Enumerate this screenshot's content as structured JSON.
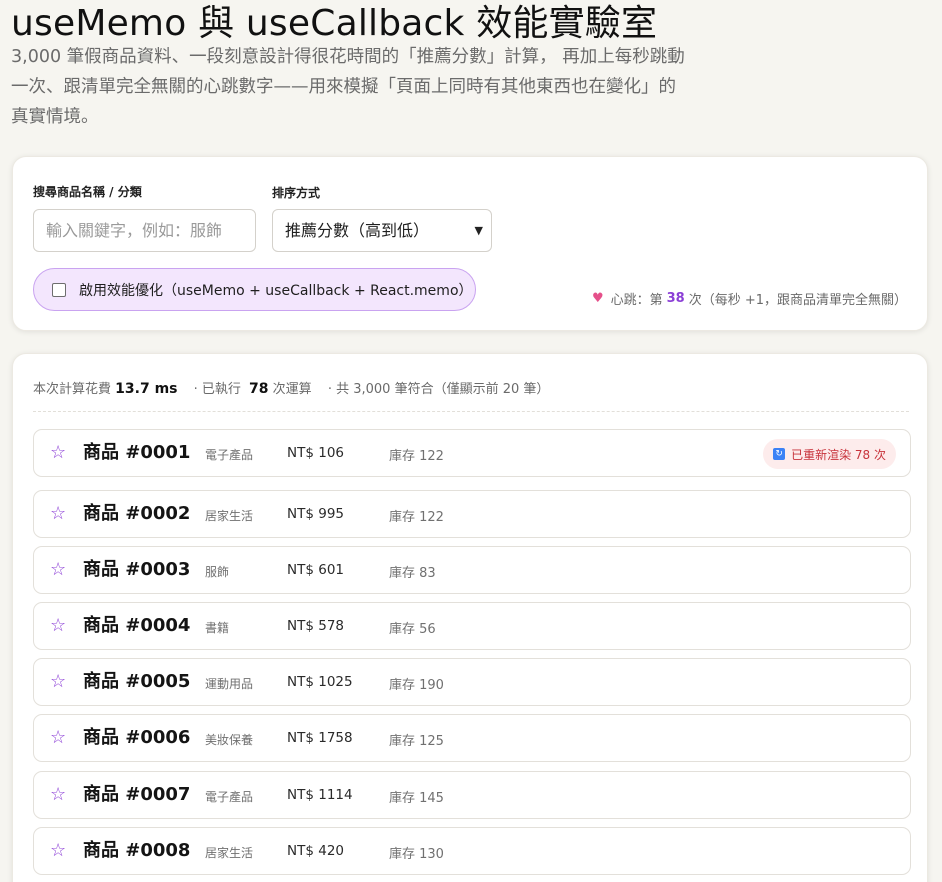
{
  "header": {
    "title": "useMemo 與 useCallback 效能實驗室",
    "subtitle": "3,000 筆假商品資料、一段刻意設計得很花時間的「推薦分數」計算， 再加上每秒跳動一次、跟清單完全無關的心跳數字——用來模擬「頁面上同時有其他東西也在變化」的真實情境。"
  },
  "controls": {
    "search_label": "搜尋商品名稱 / 分類",
    "search_placeholder": "輸入關鍵字，例如：服飾",
    "sort_label": "排序方式",
    "sort_value": "推薦分數（高到低）",
    "optimize_label": "啟用效能優化（useMemo + useCallback + React.memo）",
    "heartbeat": {
      "icon": "heart-icon",
      "prefix": "心跳：第",
      "count": "38",
      "suffix": "次（每秒 +1，跟商品清單完全無關）"
    }
  },
  "stats": {
    "compute_label": "本次計算花費",
    "compute_value": "13.7 ms",
    "exec_label": "· 已執行",
    "exec_value": "78",
    "exec_suffix": "次運算",
    "match_text": "· 共 3,000 筆符合（僅顯示前 20 筆）"
  },
  "rerender_badge": "已重新渲染 78 次",
  "products": [
    {
      "name": "商品 #0001",
      "category": "電子產品",
      "price": "NT$ 106",
      "stock": "庫存 122"
    },
    {
      "name": "商品 #0002",
      "category": "居家生活",
      "price": "NT$ 995",
      "stock": "庫存 122"
    },
    {
      "name": "商品 #0003",
      "category": "服飾",
      "price": "NT$ 601",
      "stock": "庫存 83"
    },
    {
      "name": "商品 #0004",
      "category": "書籍",
      "price": "NT$ 578",
      "stock": "庫存 56"
    },
    {
      "name": "商品 #0005",
      "category": "運動用品",
      "price": "NT$ 1025",
      "stock": "庫存 190"
    },
    {
      "name": "商品 #0006",
      "category": "美妝保養",
      "price": "NT$ 1758",
      "stock": "庫存 125"
    },
    {
      "name": "商品 #0007",
      "category": "電子產品",
      "price": "NT$ 1114",
      "stock": "庫存 145"
    },
    {
      "name": "商品 #0008",
      "category": "居家生活",
      "price": "NT$ 420",
      "stock": "庫存 130"
    }
  ],
  "colors": {
    "accent": "#8b3fd6",
    "toggle_bg": "#f3e6fd",
    "badge_text": "#c8333b"
  }
}
